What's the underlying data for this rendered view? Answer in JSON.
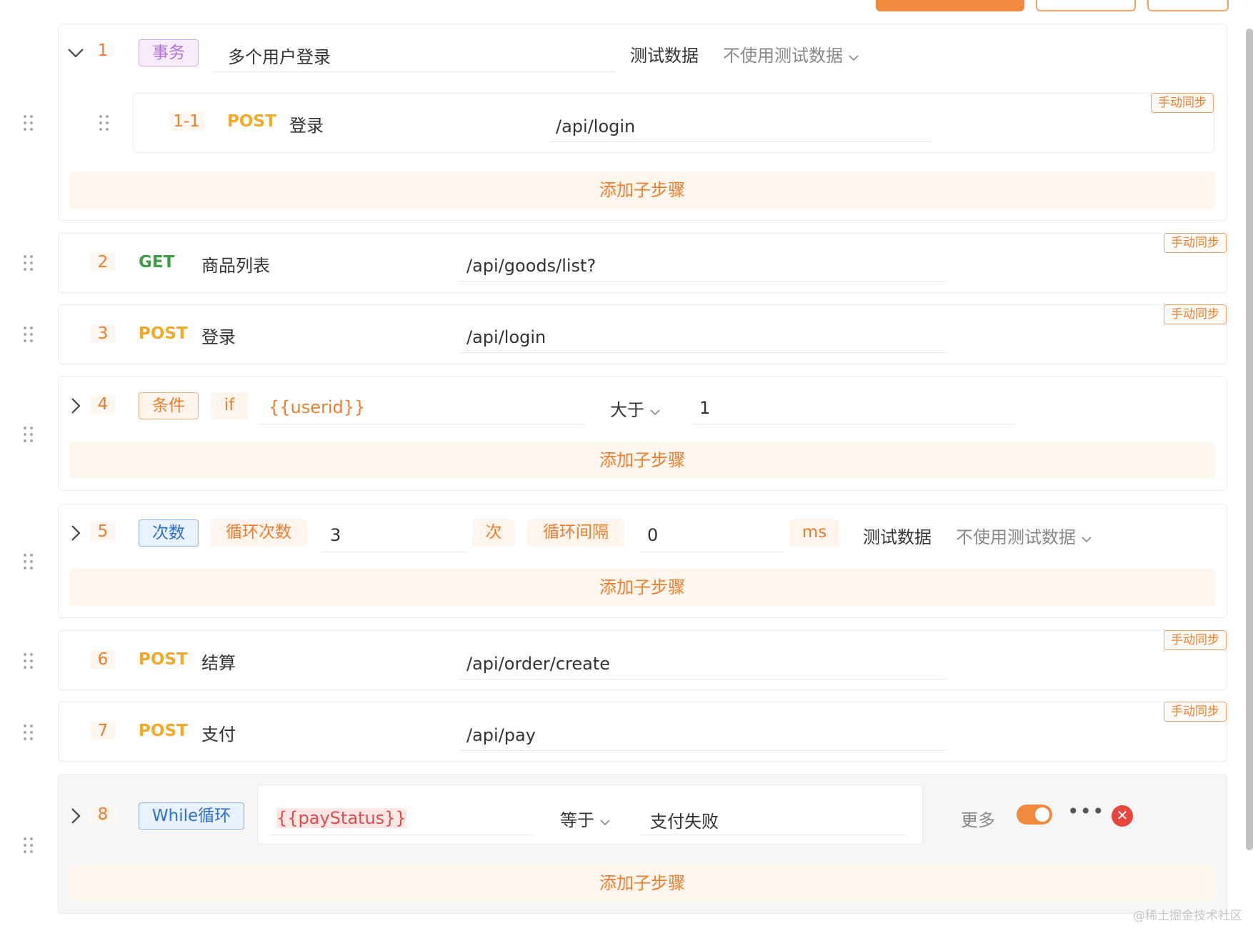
{
  "colors": {
    "accent": "#f07d2c",
    "post": "#f3a92a",
    "get": "#3f9e44",
    "danger": "#e8453c"
  },
  "steps": [
    {
      "num": "1",
      "tag": "事务",
      "name": "多个用户登录",
      "test_label": "测试数据",
      "test_select": "不使用测试数据",
      "child": {
        "num": "1-1",
        "method": "POST",
        "name": "登录",
        "path": "/api/login",
        "sync": "手动同步"
      },
      "add_sub": "添加子步骤"
    },
    {
      "num": "2",
      "method": "GET",
      "name": "商品列表",
      "path": "/api/goods/list?",
      "sync": "手动同步"
    },
    {
      "num": "3",
      "method": "POST",
      "name": "登录",
      "path": "/api/login",
      "sync": "手动同步"
    },
    {
      "num": "4",
      "tag": "条件",
      "keyword": "if",
      "variable": "{{userid}}",
      "operator": "大于",
      "value": "1",
      "add_sub": "添加子步骤"
    },
    {
      "num": "5",
      "tag": "次数",
      "count_label": "循环次数",
      "count": "3",
      "count_unit": "次",
      "interval_label": "循环间隔",
      "interval": "0",
      "interval_unit": "ms",
      "test_label": "测试数据",
      "test_select": "不使用测试数据",
      "add_sub": "添加子步骤"
    },
    {
      "num": "6",
      "method": "POST",
      "name": "结算",
      "path": "/api/order/create",
      "sync": "手动同步"
    },
    {
      "num": "7",
      "method": "POST",
      "name": "支付",
      "path": "/api/pay",
      "sync": "手动同步"
    },
    {
      "num": "8",
      "tag": "While循环",
      "variable": "{{payStatus}}",
      "operator": "等于",
      "value": "支付失败",
      "more": "更多",
      "toggle_on": true,
      "add_sub": "添加子步骤"
    }
  ],
  "watermark": "@稀土掘金技术社区"
}
